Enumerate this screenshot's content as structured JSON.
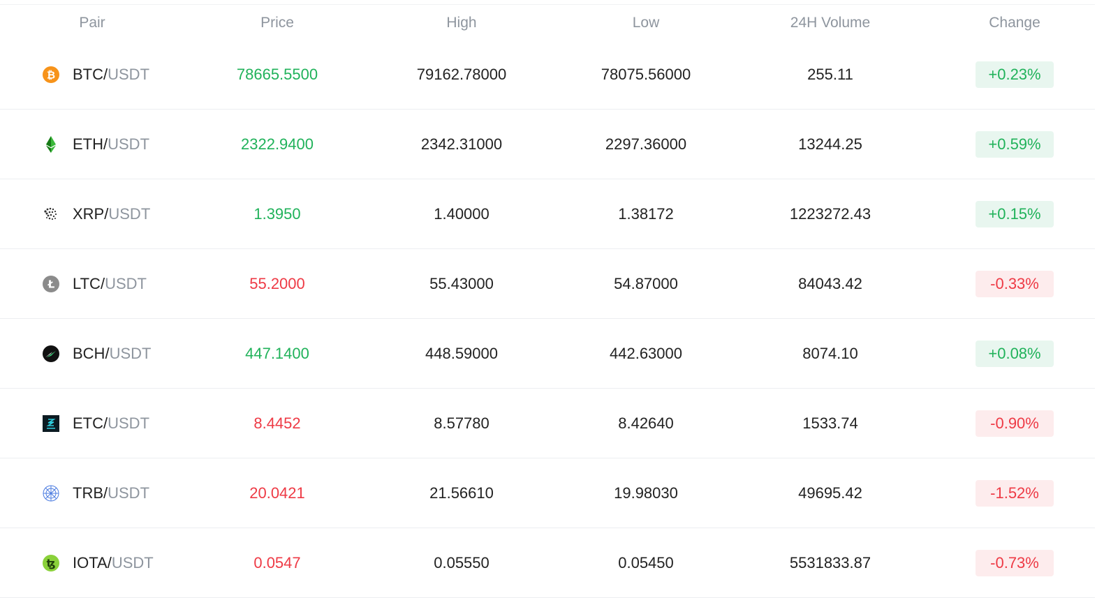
{
  "columns": {
    "pair": "Pair",
    "price": "Price",
    "high": "High",
    "low": "Low",
    "volume": "24H Volume",
    "change": "Change"
  },
  "colors": {
    "up": "#20b25a",
    "down": "#ee3a45",
    "up_bg": "#e8f6ef",
    "down_bg": "#fdeced",
    "muted": "#8e959e",
    "text": "#222222"
  },
  "rows": [
    {
      "icon": "btc-icon",
      "base": "BTC",
      "slash": "/",
      "quote": "USDT",
      "price": "78665.5500",
      "high": "79162.78000",
      "low": "78075.56000",
      "volume": "255.11",
      "change": "+0.23%",
      "trend": "up"
    },
    {
      "icon": "eth-icon",
      "base": "ETH",
      "slash": "/",
      "quote": "USDT",
      "price": "2322.9400",
      "high": "2342.31000",
      "low": "2297.36000",
      "volume": "13244.25",
      "change": "+0.59%",
      "trend": "up"
    },
    {
      "icon": "xrp-icon",
      "base": "XRP",
      "slash": "/",
      "quote": "USDT",
      "price": "1.3950",
      "high": "1.40000",
      "low": "1.38172",
      "volume": "1223272.43",
      "change": "+0.15%",
      "trend": "up"
    },
    {
      "icon": "ltc-icon",
      "base": "LTC",
      "slash": "/",
      "quote": "USDT",
      "price": "55.2000",
      "high": "55.43000",
      "low": "54.87000",
      "volume": "84043.42",
      "change": "-0.33%",
      "trend": "down"
    },
    {
      "icon": "bch-icon",
      "base": "BCH",
      "slash": "/",
      "quote": "USDT",
      "price": "447.1400",
      "high": "448.59000",
      "low": "442.63000",
      "volume": "8074.10",
      "change": "+0.08%",
      "trend": "up"
    },
    {
      "icon": "etc-icon",
      "base": "ETC",
      "slash": "/",
      "quote": "USDT",
      "price": "8.4452",
      "high": "8.57780",
      "low": "8.42640",
      "volume": "1533.74",
      "change": "-0.90%",
      "trend": "down"
    },
    {
      "icon": "trb-icon",
      "base": "TRB",
      "slash": "/",
      "quote": "USDT",
      "price": "20.0421",
      "high": "21.56610",
      "low": "19.98030",
      "volume": "49695.42",
      "change": "-1.52%",
      "trend": "down"
    },
    {
      "icon": "iota-icon",
      "base": "IOTA",
      "slash": "/",
      "quote": "USDT",
      "price": "0.0547",
      "high": "0.05550",
      "low": "0.05450",
      "volume": "5531833.87",
      "change": "-0.73%",
      "trend": "down"
    }
  ]
}
